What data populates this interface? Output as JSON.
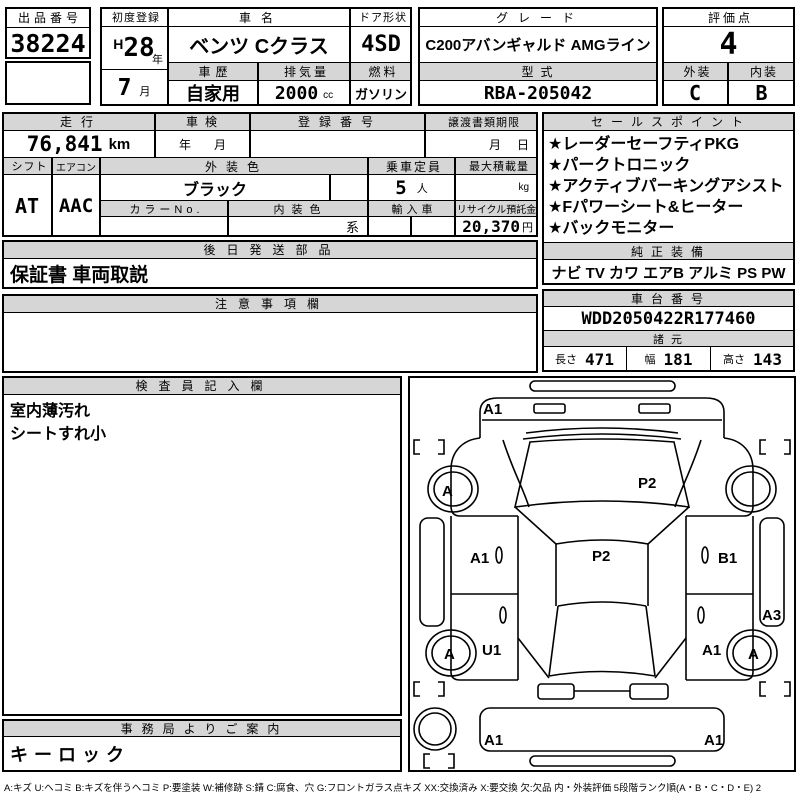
{
  "doc": {
    "exhibit": {
      "label": "出品番号",
      "value": "38224"
    },
    "first_reg": {
      "label": "初度登録",
      "era": "H",
      "year": "28",
      "year_unit": "年",
      "month": "7",
      "month_unit": "月"
    },
    "car_name": {
      "label": "車名",
      "value": "ベンツ Cクラス"
    },
    "door": {
      "label": "ドア形状",
      "value": "4SD"
    },
    "history": {
      "label": "車歴",
      "value": "自家用"
    },
    "displacement": {
      "label": "排気量",
      "value": "2000",
      "unit": "cc"
    },
    "fuel": {
      "label": "燃料",
      "value": "ガソリン"
    },
    "grade": {
      "label": "グレード",
      "value": "C200アバンギャルド AMGライン"
    },
    "model": {
      "label": "型式",
      "value": "RBA-205042"
    },
    "score": {
      "label": "評価点",
      "value": "4"
    },
    "exterior": {
      "label": "外装",
      "value": "C"
    },
    "interior": {
      "label": "内装",
      "value": "B"
    },
    "mileage": {
      "label": "走行",
      "value": "76,841",
      "unit": "km"
    },
    "inspection": {
      "label": "車検",
      "year_ph": "年",
      "month_ph": "月"
    },
    "reg_no": {
      "label": "登録番号",
      "value": ""
    },
    "transfer": {
      "label": "譲渡書類期限",
      "month_ph": "月",
      "day_ph": "日"
    },
    "shift": {
      "label": "シフト",
      "value": "AT"
    },
    "ac": {
      "label": "エアコン",
      "value": "AAC"
    },
    "ext_color": {
      "label": "外装色",
      "value": "ブラック"
    },
    "capacity": {
      "label": "乗車定員",
      "value": "5",
      "unit": "人"
    },
    "max_load": {
      "label": "最大積載量",
      "value": "",
      "unit": "kg"
    },
    "color_no": {
      "label": "カラーNo.",
      "value": ""
    },
    "int_color": {
      "label": "内装色",
      "suffix": "系"
    },
    "imported": {
      "label": "輸入車"
    },
    "recycle": {
      "label": "リサイクル預託金",
      "value": "20,370",
      "unit": "円"
    },
    "later_parts": {
      "label": "後日発送部品",
      "value": "保証書 車両取説"
    },
    "caution": {
      "label": "注意事項欄",
      "value": ""
    },
    "sales": {
      "label": "セールスポイント",
      "items": [
        "★レーダーセーフティPKG",
        "★パークトロニック",
        "★アクティブパーキングアシスト",
        "★Fパワーシート&ヒーター",
        "★バックモニター"
      ]
    },
    "equipment": {
      "label": "純正装備",
      "value": "ナビ TV カワ エアB アルミ PS PW"
    },
    "chassis": {
      "label": "車台番号",
      "value": "WDD2050422R177460"
    },
    "specs": {
      "label": "諸元",
      "length_label": "長さ",
      "length": "471",
      "width_label": "幅",
      "width": "181",
      "height_label": "高さ",
      "height": "143"
    },
    "inspector": {
      "label": "検査員記入欄",
      "lines": [
        "室内薄汚れ",
        "シートすれ小"
      ]
    },
    "office": {
      "label": "事務局よりご案内",
      "value": "キーロック"
    },
    "diagram": {
      "labels": [
        {
          "code": "A1",
          "part": "front-bumper-left"
        },
        {
          "code": "P2",
          "part": "windshield"
        },
        {
          "code": "A",
          "part": "front-left-tire"
        },
        {
          "code": "A1",
          "part": "left-front-door"
        },
        {
          "code": "P2",
          "part": "roof"
        },
        {
          "code": "B1",
          "part": "right-front-door"
        },
        {
          "code": "A3",
          "part": "right-rear-rocker"
        },
        {
          "code": "U1",
          "part": "left-rear-door"
        },
        {
          "code": "A",
          "part": "left-rear-tire"
        },
        {
          "code": "A1",
          "part": "right-rear-door"
        },
        {
          "code": "A",
          "part": "right-rear-tire"
        },
        {
          "code": "A1",
          "part": "rear-bumper-left"
        },
        {
          "code": "A1",
          "part": "rear-bumper-right"
        }
      ]
    },
    "footer": {
      "legend": "A:キズ U:ヘコミ B:キズを伴うヘコミ P:要塗装 W:補修跡 S:錆 C:腐食、穴 G:フロントガラス点キズ XX:交換済み X:要交換 欠:欠品 内・外装評価 5段階ランク順(A・B・C・D・E) 2"
    }
  }
}
